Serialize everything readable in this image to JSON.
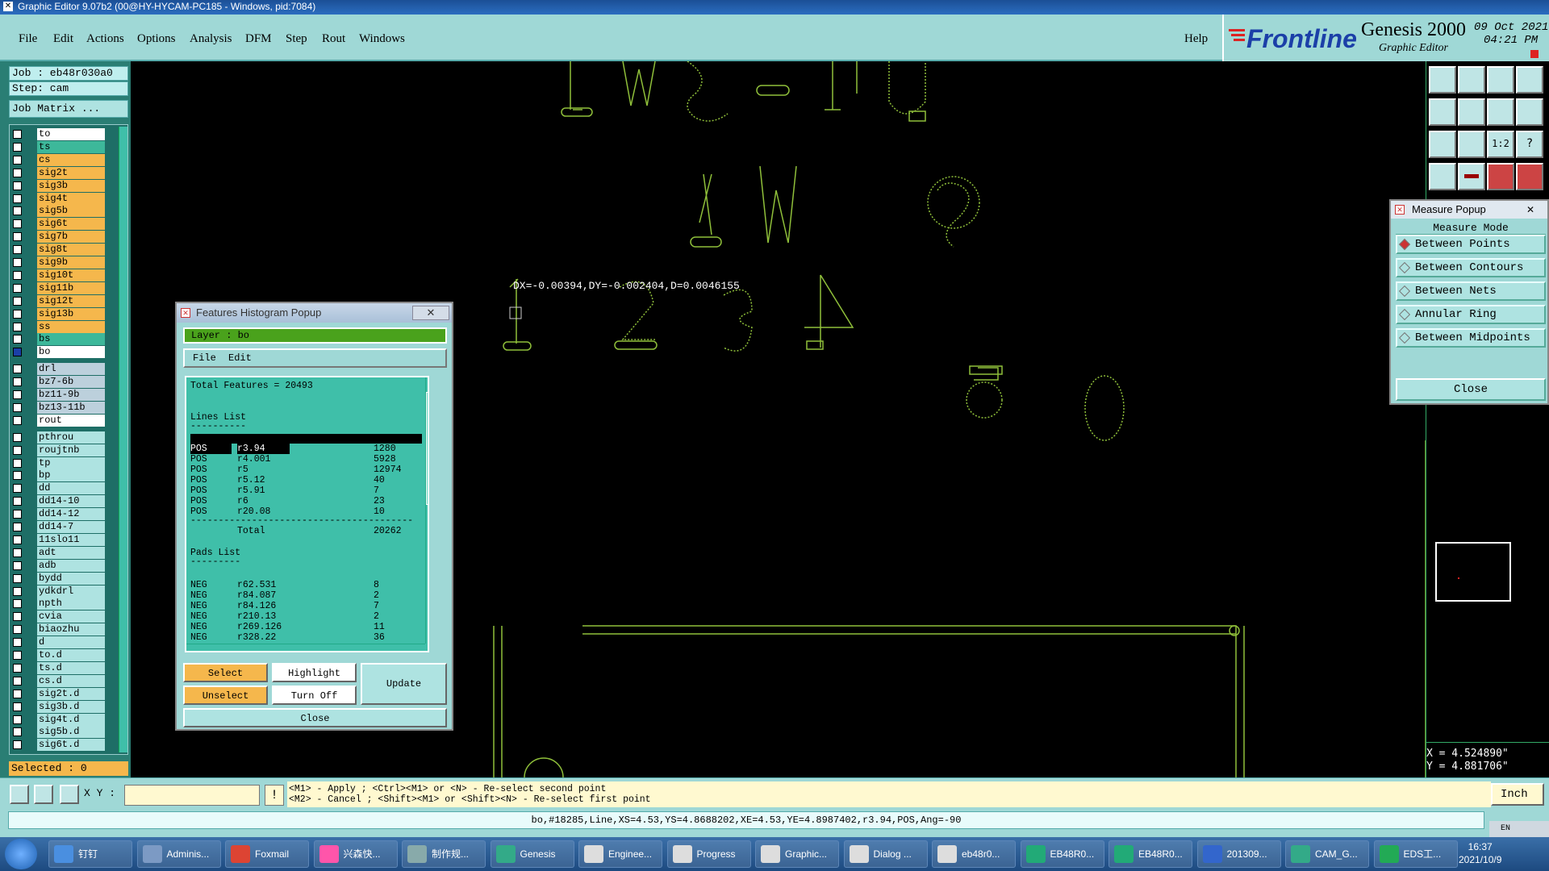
{
  "window": {
    "title": "Graphic Editor 9.07b2 (00@HY-HYCAM-PC185 - Windows, pid:7084)"
  },
  "menu": {
    "items": [
      "File",
      "Edit",
      "Actions",
      "Options",
      "Analysis",
      "DFM",
      "Step",
      "Rout",
      "Windows"
    ],
    "help": "Help"
  },
  "logo": {
    "brand": "Frontline",
    "product": "Genesis 2000",
    "subtitle": "Graphic Editor",
    "date": "09 Oct 2021",
    "time": "04:21 PM"
  },
  "job": {
    "job": "Job : eb48r030a0",
    "step": "Step: cam",
    "matrix": "Job Matrix ..."
  },
  "layers": [
    {
      "name": "to",
      "color": "#ffffff"
    },
    {
      "name": "ts",
      "color": "#3db89a"
    },
    {
      "name": "cs",
      "color": "#f5b74c"
    },
    {
      "name": "sig2t",
      "color": "#f5b74c"
    },
    {
      "name": "sig3b",
      "color": "#f5b74c"
    },
    {
      "name": "sig4t",
      "color": "#f5b74c"
    },
    {
      "name": "sig5b",
      "color": "#f5b74c"
    },
    {
      "name": "sig6t",
      "color": "#f5b74c"
    },
    {
      "name": "sig7b",
      "color": "#f5b74c"
    },
    {
      "name": "sig8t",
      "color": "#f5b74c"
    },
    {
      "name": "sig9b",
      "color": "#f5b74c"
    },
    {
      "name": "sig10t",
      "color": "#f5b74c"
    },
    {
      "name": "sig11b",
      "color": "#f5b74c"
    },
    {
      "name": "sig12t",
      "color": "#f5b74c"
    },
    {
      "name": "sig13b",
      "color": "#f5b74c"
    },
    {
      "name": "ss",
      "color": "#f5b74c"
    },
    {
      "name": "bs",
      "color": "#3db89a"
    },
    {
      "name": "bo",
      "color": "#ffffff"
    },
    {
      "name": "drl",
      "color": "#bcd0dc"
    },
    {
      "name": "bz7-6b",
      "color": "#bcd0dc"
    },
    {
      "name": "bz11-9b",
      "color": "#bcd0dc"
    },
    {
      "name": "bz13-11b",
      "color": "#bcd0dc"
    },
    {
      "name": "rout",
      "color": "#ffffff"
    },
    {
      "name": "pthrou",
      "color": "#aee3e1"
    },
    {
      "name": "roujtnb",
      "color": "#aee3e1"
    },
    {
      "name": "tp",
      "color": "#aee3e1"
    },
    {
      "name": "bp",
      "color": "#aee3e1"
    },
    {
      "name": "dd",
      "color": "#aee3e1"
    },
    {
      "name": "dd14-10",
      "color": "#aee3e1"
    },
    {
      "name": "dd14-12",
      "color": "#aee3e1"
    },
    {
      "name": "dd14-7",
      "color": "#aee3e1"
    },
    {
      "name": "11slo11",
      "color": "#aee3e1"
    },
    {
      "name": "adt",
      "color": "#aee3e1"
    },
    {
      "name": "adb",
      "color": "#aee3e1"
    },
    {
      "name": "bydd",
      "color": "#aee3e1"
    },
    {
      "name": "ydkdrl",
      "color": "#aee3e1"
    },
    {
      "name": "npth",
      "color": "#aee3e1"
    },
    {
      "name": "cvia",
      "color": "#aee3e1"
    },
    {
      "name": "biaozhu",
      "color": "#aee3e1"
    },
    {
      "name": "d",
      "color": "#aee3e1"
    },
    {
      "name": "to.d",
      "color": "#aee3e1"
    },
    {
      "name": "ts.d",
      "color": "#aee3e1"
    },
    {
      "name": "cs.d",
      "color": "#aee3e1"
    },
    {
      "name": "sig2t.d",
      "color": "#aee3e1"
    },
    {
      "name": "sig3b.d",
      "color": "#aee3e1"
    },
    {
      "name": "sig4t.d",
      "color": "#aee3e1"
    },
    {
      "name": "sig5b.d",
      "color": "#aee3e1"
    },
    {
      "name": "sig6t.d",
      "color": "#aee3e1"
    }
  ],
  "selected": "Selected : 0",
  "canvas": {
    "measure_text": "DX=-0.00394,DY=-0.002404,D=0.0046155",
    "coord_x": "X = 4.524890\"",
    "coord_y": "Y = 4.881706\""
  },
  "measure_popup": {
    "title": "Measure Popup",
    "mode_label": "Measure Mode",
    "options": [
      "Between Points",
      "Between Contours",
      "Between Nets",
      "Annular Ring",
      "Between Midpoints"
    ],
    "selected": "Between Points",
    "close": "Close"
  },
  "histogram": {
    "title": "Features Histogram Popup",
    "layer_label": "Layer :  bo",
    "menu": [
      "File",
      "Edit"
    ],
    "total": "Total Features = 20493",
    "lines_header": "Lines List",
    "lines": [
      {
        "pol": "POS",
        "sym": "r3.94",
        "count": "1280"
      },
      {
        "pol": "POS",
        "sym": "r4.001",
        "count": "5928"
      },
      {
        "pol": "POS",
        "sym": "r5",
        "count": "12974"
      },
      {
        "pol": "POS",
        "sym": "r5.12",
        "count": "40"
      },
      {
        "pol": "POS",
        "sym": "r5.91",
        "count": "7"
      },
      {
        "pol": "POS",
        "sym": "r6",
        "count": "23"
      },
      {
        "pol": "POS",
        "sym": "r20.08",
        "count": "10"
      }
    ],
    "lines_total_label": "Total",
    "lines_total": "20262",
    "pads_header": "Pads List",
    "pads": [
      {
        "pol": "NEG",
        "sym": "r62.531",
        "count": "8"
      },
      {
        "pol": "NEG",
        "sym": "r84.087",
        "count": "2"
      },
      {
        "pol": "NEG",
        "sym": "r84.126",
        "count": "7"
      },
      {
        "pol": "NEG",
        "sym": "r210.13",
        "count": "2"
      },
      {
        "pol": "NEG",
        "sym": "r269.126",
        "count": "11"
      },
      {
        "pol": "NEG",
        "sym": "r328.22",
        "count": "36"
      }
    ],
    "buttons": {
      "select": "Select",
      "highlight": "Highlight",
      "update": "Update",
      "unselect": "Unselect",
      "turn_off": "Turn Off",
      "close": "Close"
    }
  },
  "bottom": {
    "xy_label": "X Y :",
    "hint1": "<M1> - Apply  ; <Ctrl><M1> or <N> - Re-select second point",
    "hint2": "<M2> - Cancel ; <Shift><M1> or <Shift><N> - Re-select first point",
    "units": "Inch"
  },
  "status": "bo,#18285,Line,XS=4.53,YS=4.8688202,XE=4.53,YE=4.8987402,r3.94,POS,Ang=-90",
  "taskbar": {
    "items": [
      "钉钉",
      "Adminis...",
      "Foxmail",
      "兴森快...",
      "制作规...",
      "Genesis",
      "Enginee...",
      "Progress",
      "Graphic...",
      "Dialog ...",
      "eb48r0...",
      "EB48R0...",
      "EB48R0...",
      "201309...",
      "CAM_G...",
      "EDS工..."
    ],
    "time": "16:37",
    "date": "2021/10/9",
    "lang": "EN"
  }
}
